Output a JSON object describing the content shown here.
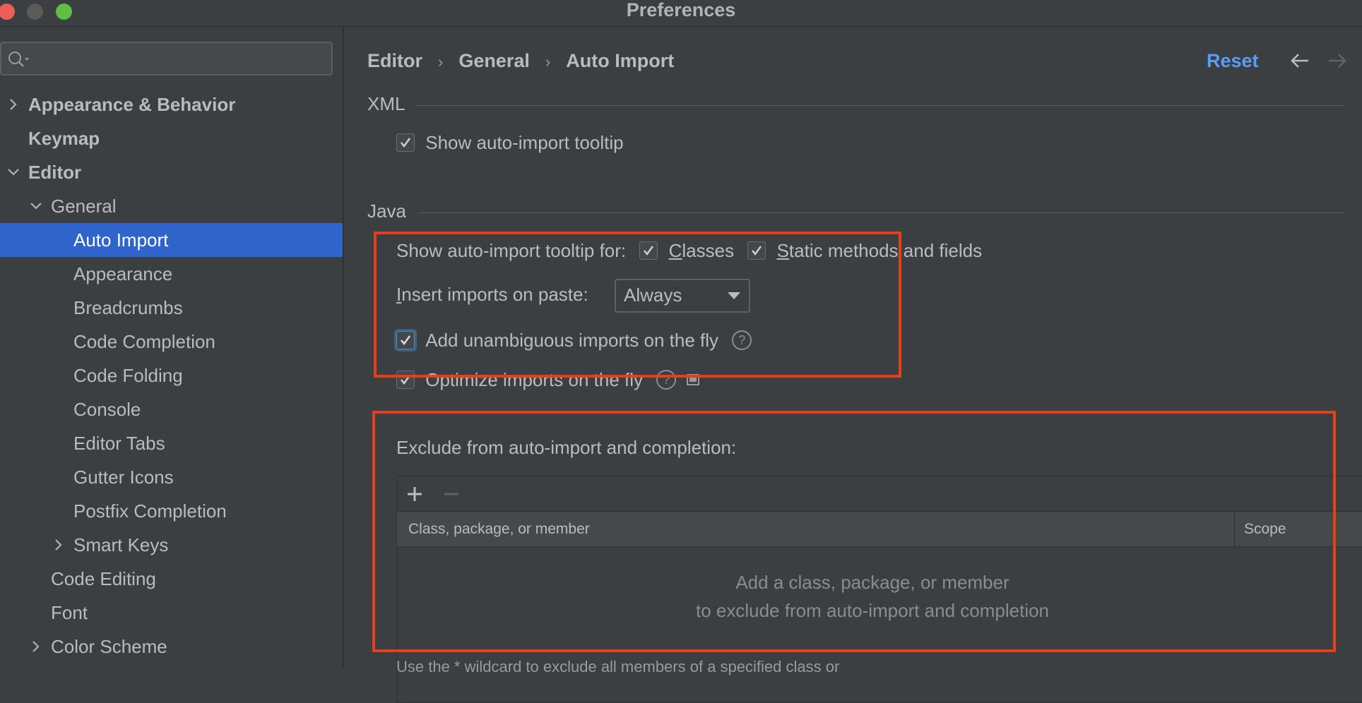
{
  "window": {
    "title": "Preferences"
  },
  "sidebar": {
    "search_placeholder": "",
    "items": [
      {
        "label": "Appearance & Behavior"
      },
      {
        "label": "Keymap"
      },
      {
        "label": "Editor"
      },
      {
        "label": "General"
      },
      {
        "label": "Auto Import"
      },
      {
        "label": "Appearance"
      },
      {
        "label": "Breadcrumbs"
      },
      {
        "label": "Code Completion"
      },
      {
        "label": "Code Folding"
      },
      {
        "label": "Console"
      },
      {
        "label": "Editor Tabs"
      },
      {
        "label": "Gutter Icons"
      },
      {
        "label": "Postfix Completion"
      },
      {
        "label": "Smart Keys"
      },
      {
        "label": "Code Editing"
      },
      {
        "label": "Font"
      },
      {
        "label": "Color Scheme"
      }
    ]
  },
  "header": {
    "breadcrumb": [
      "Editor",
      "General",
      "Auto Import"
    ],
    "reset_label": "Reset"
  },
  "xml": {
    "section_title": "XML",
    "show_tooltip_label": "Show auto-import tooltip",
    "show_tooltip_checked": true
  },
  "java": {
    "section_title": "Java",
    "tooltip_for_label": "Show auto-import tooltip for:",
    "classes_label_u": "C",
    "classes_label_rest": "lasses",
    "classes_checked": true,
    "static_label_u": "S",
    "static_label_rest": "tatic methods and fields",
    "static_checked": true,
    "insert_label_u": "I",
    "insert_label_rest": "nsert imports on paste:",
    "insert_value": "Always",
    "unambiguous_label": "Add unambiguous imports on the fly",
    "unambiguous_checked": true,
    "optimize_label": "Optimize imports on the fly",
    "optimize_checked": true,
    "help_glyph": "?",
    "exclude_label": "Exclude from auto-import and completion:",
    "table": {
      "columns": [
        "Class, package, or member",
        "Scope"
      ],
      "empty_line1": "Add a class, package, or member",
      "empty_line2": "to exclude from auto-import and completion"
    },
    "cut_text": "Use the * wildcard to exclude all members of a specified class or"
  }
}
